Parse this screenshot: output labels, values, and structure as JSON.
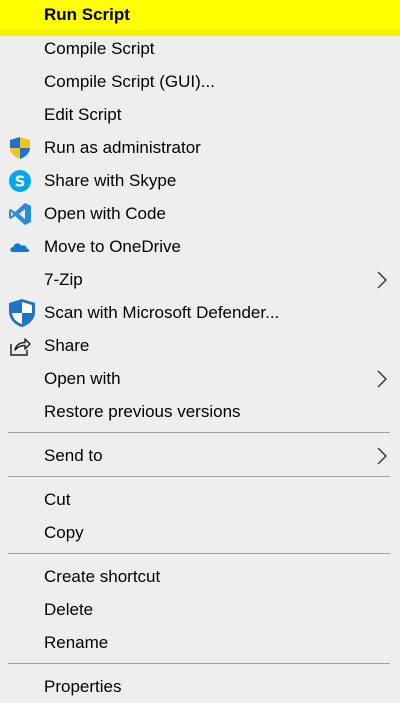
{
  "menu": {
    "items": [
      {
        "label": "Run Script",
        "highlight": true
      },
      {
        "label": "Compile Script"
      },
      {
        "label": "Compile Script (GUI)..."
      },
      {
        "label": "Edit Script"
      },
      {
        "label": "Run as administrator",
        "icon": "uac-shield-icon"
      },
      {
        "label": "Share with Skype",
        "icon": "skype-icon"
      },
      {
        "label": "Open with Code",
        "icon": "vscode-icon"
      },
      {
        "label": "Move to OneDrive",
        "icon": "onedrive-icon"
      },
      {
        "label": "7-Zip",
        "submenu": true
      },
      {
        "label": "Scan with Microsoft Defender...",
        "icon": "defender-shield-icon"
      },
      {
        "label": "Share",
        "icon": "share-icon"
      },
      {
        "label": "Open with",
        "submenu": true
      },
      {
        "label": "Restore previous versions"
      },
      {
        "label": "Send to",
        "submenu": true
      },
      {
        "label": "Cut"
      },
      {
        "label": "Copy"
      },
      {
        "label": "Create shortcut"
      },
      {
        "label": "Delete"
      },
      {
        "label": "Rename"
      },
      {
        "label": "Properties"
      }
    ]
  },
  "colors": {
    "background": "#eeeeee",
    "highlight": "#ffff00",
    "separator": "#a0a0a0",
    "skype": "#00a8e8",
    "vscode": "#2a8dd8",
    "onedrive": "#0f78d4",
    "defender": "#1e73c8"
  }
}
